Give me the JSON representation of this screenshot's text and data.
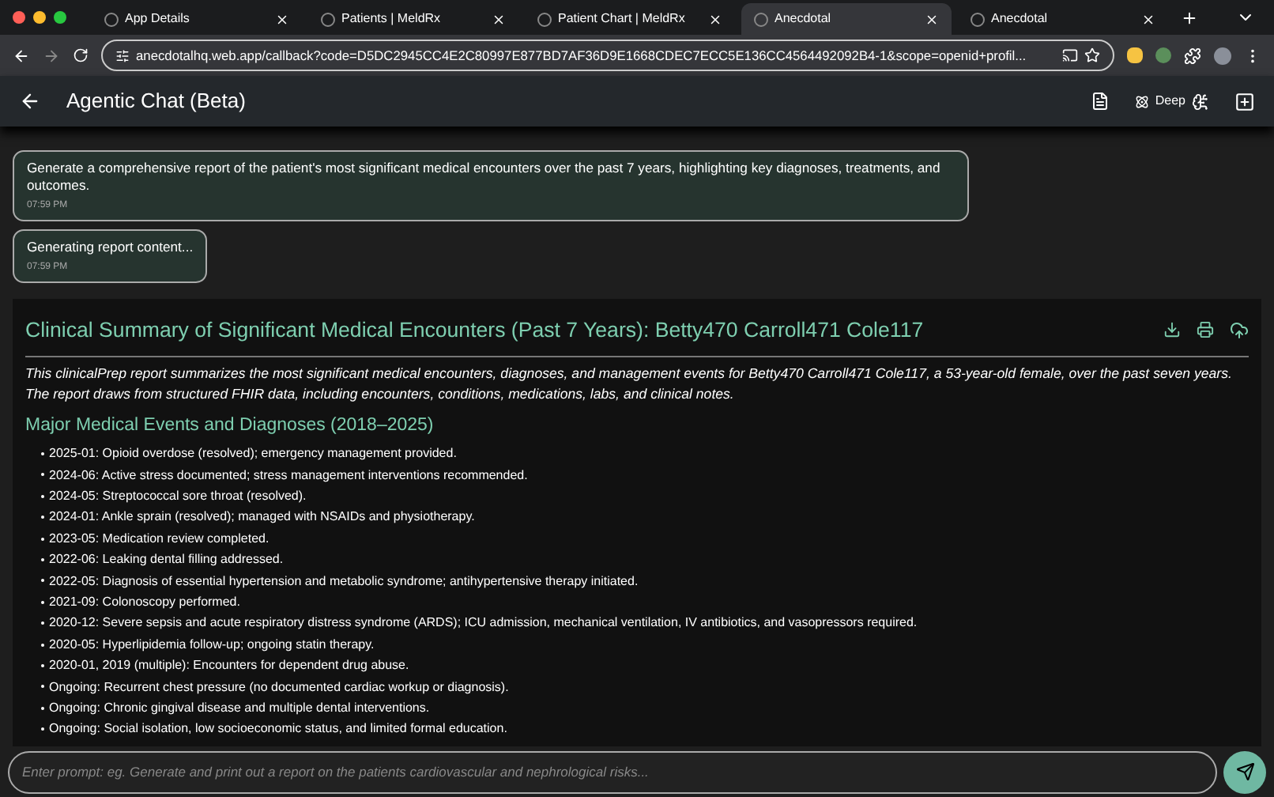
{
  "browser": {
    "tabs": [
      {
        "title": "App Details",
        "selected": false
      },
      {
        "title": "Patients | MeldRx",
        "selected": false
      },
      {
        "title": "Patient Chart | MeldRx",
        "selected": false
      },
      {
        "title": "Anecdotal",
        "selected": true
      },
      {
        "title": "Anecdotal",
        "selected": false
      }
    ],
    "url": "anecdotalhq.web.app/callback?code=D5DC2945CC4E2C80997E877BD7AF36D9E1668CDEC7ECC5E136CC4564492092B4-1&scope=openid+profil..."
  },
  "header": {
    "title": "Agentic Chat (Beta)",
    "mode": "Deep"
  },
  "messages": [
    {
      "text": "Generate a comprehensive report of the patient's most significant medical encounters over the past 7 years, highlighting key diagnoses, treatments, and outcomes.",
      "time": "07:59 PM"
    },
    {
      "text": "Generating report content...",
      "time": "07:59 PM"
    }
  ],
  "report": {
    "title": "Clinical Summary of Significant Medical Encounters (Past 7 Years): Betty470 Carroll471 Cole117",
    "intro": "This clinicalPrep report summarizes the most significant medical encounters, diagnoses, and management events for Betty470 Carroll471 Cole117, a 53-year-old female, over the past seven years. The report draws from structured FHIR data, including encounters, conditions, medications, labs, and clinical notes.",
    "section_title": "Major Medical Events and Diagnoses (2018–2025)",
    "items": [
      "2025-01: Opioid overdose (resolved); emergency management provided.",
      "2024-06: Active stress documented; stress management interventions recommended.",
      "2024-05: Streptococcal sore throat (resolved).",
      "2024-01: Ankle sprain (resolved); managed with NSAIDs and physiotherapy.",
      "2023-05: Medication review completed.",
      "2022-06: Leaking dental filling addressed.",
      "2022-05: Diagnosis of essential hypertension and metabolic syndrome; antihypertensive therapy initiated.",
      "2021-09: Colonoscopy performed.",
      "2020-12: Severe sepsis and acute respiratory distress syndrome (ARDS); ICU admission, mechanical ventilation, IV antibiotics, and vasopressors required.",
      "2020-05: Hyperlipidemia follow-up; ongoing statin therapy.",
      "2020-01, 2019 (multiple): Encounters for dependent drug abuse.",
      "Ongoing: Recurrent chest pressure (no documented cardiac workup or diagnosis).",
      "Ongoing: Chronic gingival disease and multiple dental interventions.",
      "Ongoing: Social isolation, low socioeconomic status, and limited formal education."
    ]
  },
  "prompt": {
    "placeholder": "Enter prompt: eg. Generate and print out a report on the patients cardiovascular and nephrological risks..."
  }
}
